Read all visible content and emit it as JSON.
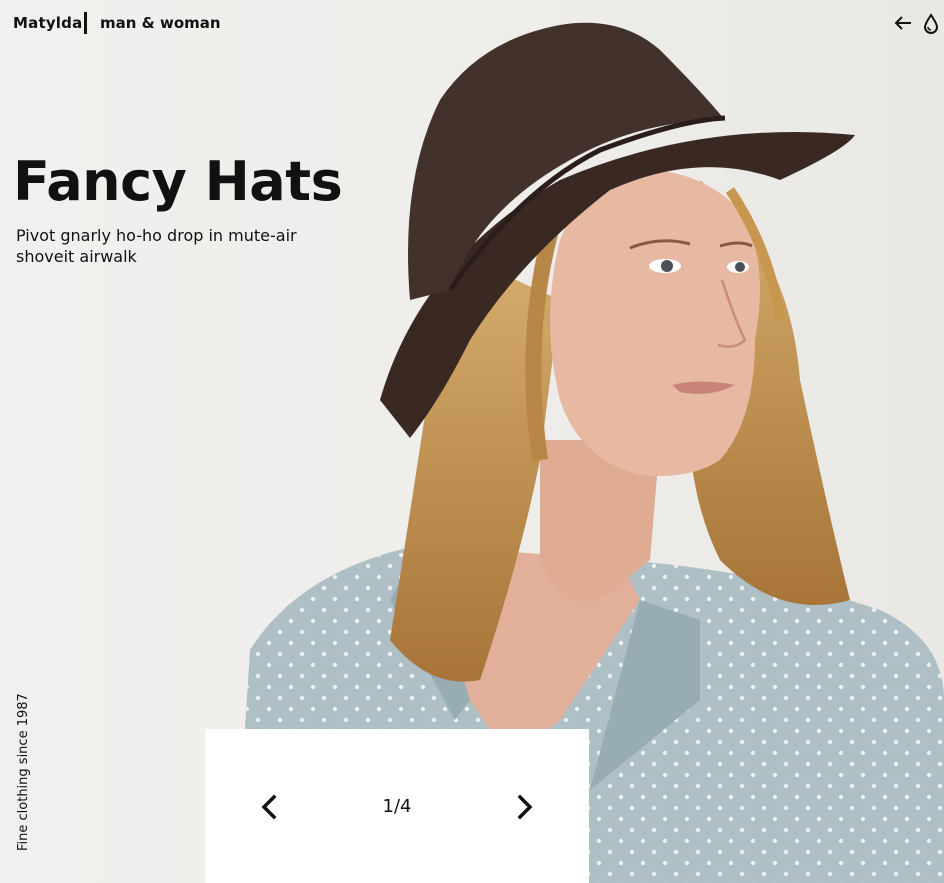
{
  "header": {
    "brand": "Matylda",
    "tagline": "man & woman",
    "back_icon": "arrow-left-icon",
    "drop_icon": "drop-icon"
  },
  "hero": {
    "image": "woman-in-brown-hat-photo",
    "title": "Fancy Hats",
    "subtitle": "Pivot gnarly ho-ho drop in mute-air shoveit airwalk"
  },
  "side": {
    "text": "Fine clothing since 1987"
  },
  "pager": {
    "prev_icon": "chevron-left-icon",
    "next_icon": "chevron-right-icon",
    "current": "1",
    "separator": "/",
    "total": "4"
  },
  "colors": {
    "background": "#f0efed",
    "hat": "#3e2c26",
    "hair": "#c79a5a",
    "skin": "#e7b9a2",
    "shirt": "#aebfc6",
    "panel": "#ffffff"
  }
}
